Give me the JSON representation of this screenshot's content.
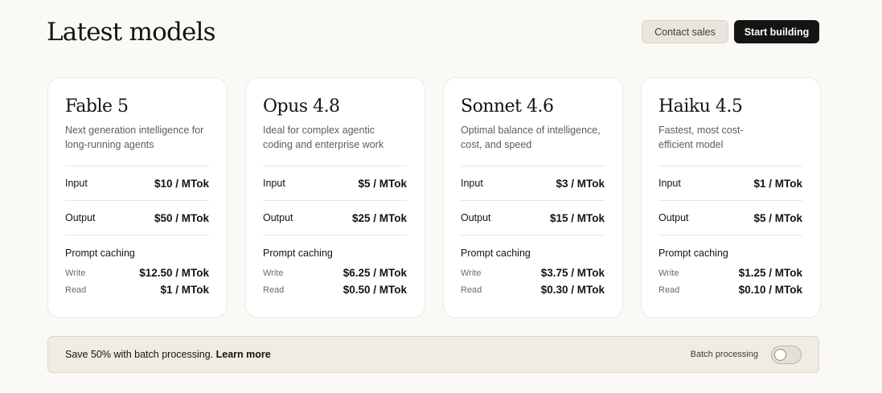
{
  "header": {
    "title": "Latest models",
    "contact_sales_label": "Contact sales",
    "start_building_label": "Start building"
  },
  "labels": {
    "input": "Input",
    "output": "Output",
    "prompt_caching": "Prompt caching",
    "write": "Write",
    "read": "Read"
  },
  "models": [
    {
      "name": "Fable 5",
      "description": "Next generation intelligence for long-running agents",
      "input": "$10 / MTok",
      "output": "$50 / MTok",
      "cache_write": "$12.50 / MTok",
      "cache_read": "$1 / MTok"
    },
    {
      "name": "Opus 4.8",
      "description": "Ideal for complex agentic coding and enterprise work",
      "input": "$5 / MTok",
      "output": "$25 / MTok",
      "cache_write": "$6.25 / MTok",
      "cache_read": "$0.50 / MTok"
    },
    {
      "name": "Sonnet 4.6",
      "description": "Optimal balance of intelligence, cost, and speed",
      "input": "$3 / MTok",
      "output": "$15 / MTok",
      "cache_write": "$3.75 / MTok",
      "cache_read": "$0.30 / MTok"
    },
    {
      "name": "Haiku 4.5",
      "description": "Fastest, most cost-efficient model",
      "input": "$1 / MTok",
      "output": "$5 / MTok",
      "cache_write": "$1.25 / MTok",
      "cache_read": "$0.10 / MTok"
    }
  ],
  "batch": {
    "text": "Save 50% with batch processing.",
    "link_label": "Learn more",
    "toggle_label": "Batch processing",
    "toggle_on": false
  },
  "colors": {
    "background": "#faf9f5",
    "primary_button": "#141413",
    "secondary_button": "#e8e6dc",
    "banner": "#efece3"
  }
}
